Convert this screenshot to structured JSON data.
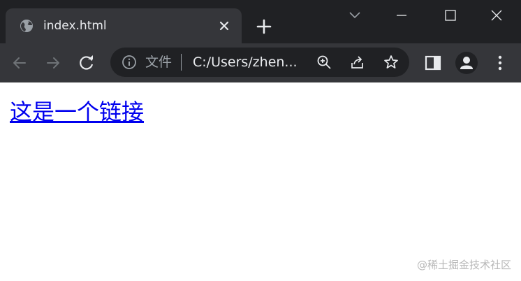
{
  "tab": {
    "title": "index.html"
  },
  "omnibox": {
    "scheme_label": "文件",
    "url": "C:/Users/zhen..."
  },
  "page": {
    "link_text": "这是一个链接"
  },
  "watermark": "@稀土掘金技术社区",
  "colors": {
    "titlebar": "#202124",
    "toolbar": "#35363a",
    "link": "#0000ee"
  }
}
